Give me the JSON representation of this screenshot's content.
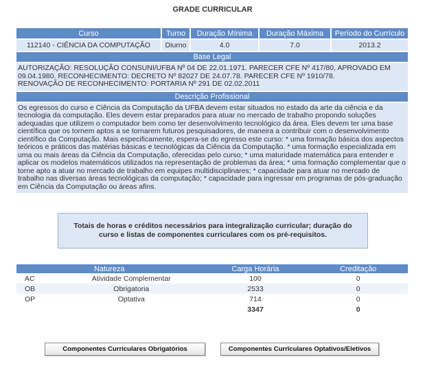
{
  "page": {
    "title": "GRADE CURRICULAR"
  },
  "curso_table": {
    "headers": [
      "Curso",
      "Turno",
      "Duração Mínima",
      "Duração Máxima",
      "Período do Currículo"
    ],
    "row": {
      "curso": "112140 - CIÊNCIA DA COMPUTAÇÃO",
      "turno": "Diurno",
      "duracao_minima": "4.0",
      "duracao_maxima": "7.0",
      "periodo": "2013.2"
    }
  },
  "base_legal": {
    "header": "Base Legal",
    "lines": [
      "AUTORIZAÇÃO: RESOLUÇÃO CONSUNI/UFBA Nº 04 DE 22.01.1971. PARECER CFE Nº 417/80, APROVADO EM 09.04.1980. RECONHECIMENTO: DECRETO Nº 82027 DE 24.07.78. PARECER CFE Nº 1910/78.",
      "RENOVAÇÃO DE RECONHECIMENTO: PORTARIA Nº 291 DE 02.02.2011"
    ]
  },
  "descricao": {
    "header": "Descrição Profissional",
    "text": "Os egressos do curso e Ciência da Computação da UFBA devem estar situados no estado da arte da ciência e da tecnologia da computação. Eles devem estar preparados para atuar no mercado de trabalho propondo soluções adequadas que utilizem o computador bem como ter desenvolvimento tecnológico da área. Eles devem ter uma base científica que os tornem aptos a se tornarem futuros pesquisadores, de maneira a contribuir com o desenvolvimento científico da Computação. Mais especificamente, espera-se do egresso este curso: * uma formação básica dos aspectos teóricos e práticos das matérias básicas e tecnológicas da Ciência da Computação. * uma formação especializada em uma ou mais áreas da Ciência da Computação, oferecidas pelo curso; * uma maturidade matemática para entender e aplicar os modelos matemáticos utilizados na representação de problemas da área; * uma formação complementar que o torne apto a atuar no mercado de trabalho em equipes multidisciplinares; * capacidade para atuar no mercado de trabalho nas diversas áreas tecnológicas da computação; * capacidade para ingressar em programas de pós-graduação em Ciência da Computação ou áreas afins."
  },
  "info_box": {
    "text": "Totais de horas e créditos necessários para integralização curricular; duração do curso e listas de componentes curriculares com os pré-requisitos."
  },
  "natureza_table": {
    "headers": [
      "Natureza",
      "Carga Horária",
      "Creditação"
    ],
    "rows": [
      {
        "code": "AC",
        "desc": "Atividade Complementar",
        "ch": "100",
        "cr": "0"
      },
      {
        "code": "OB",
        "desc": "Obrigatoria",
        "ch": "2533",
        "cr": "0"
      },
      {
        "code": "OP",
        "desc": "Optativa",
        "ch": "714",
        "cr": "0"
      }
    ],
    "total": {
      "ch": "3347",
      "cr": "0"
    }
  },
  "buttons": {
    "obrigatorios": "Componentes Curriculares Obrigatórios",
    "optativos": "Componentes Curriculares Optativos/Eletivos"
  }
}
